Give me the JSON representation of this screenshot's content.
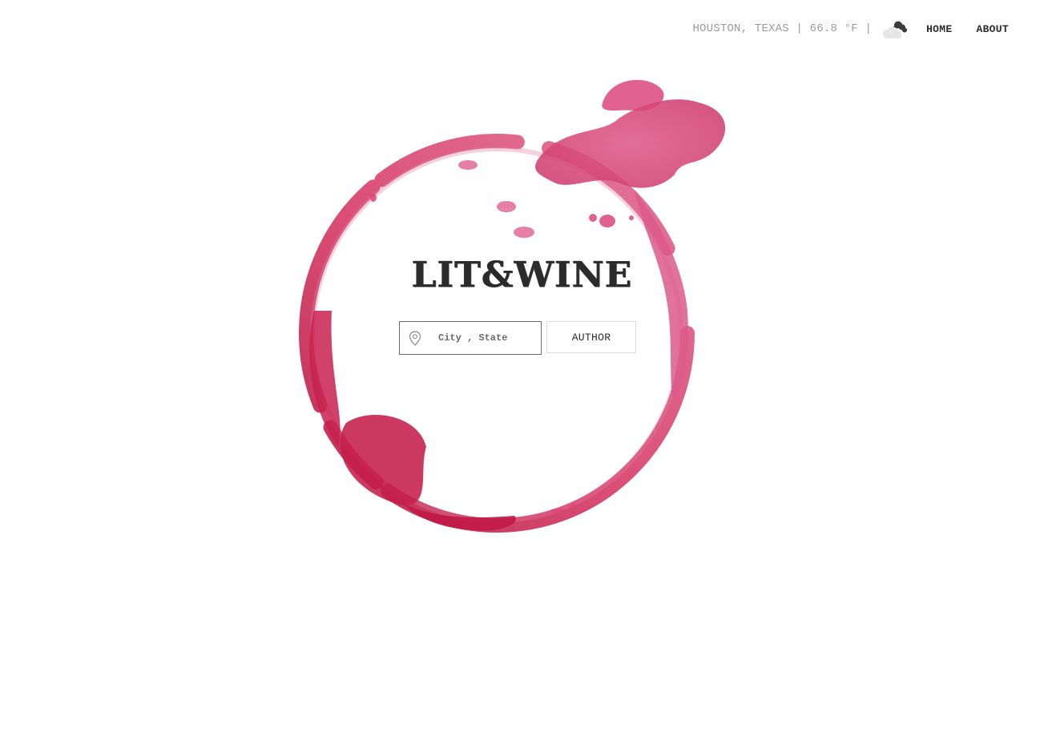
{
  "header": {
    "weather_text": "HOUSTON, TEXAS | 66.8 °F |",
    "weather_icon": "partly-cloudy-night-icon",
    "nav": {
      "home_label": "HOME",
      "about_label": "ABOUT"
    }
  },
  "hero": {
    "logo_text": "LIT&WINE",
    "background_art": "wine-stain-ring",
    "stain_color": "#d0305a"
  },
  "search": {
    "location_placeholder": "City , State",
    "location_value": "",
    "location_icon": "map-pin-icon",
    "author_button_label": "AUTHOR"
  },
  "colors": {
    "text_dark": "#2b2b2b",
    "text_muted": "#9b9b9b",
    "wine": "#d0305a",
    "wine_deep": "#b3153c"
  }
}
